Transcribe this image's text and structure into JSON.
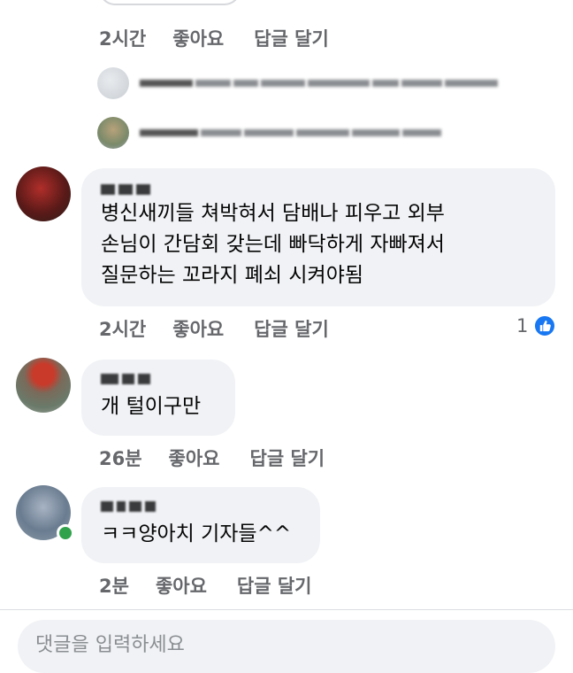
{
  "top_comment": {
    "time": "2시간",
    "like_label": "좋아요",
    "reply_label": "답글 달기"
  },
  "comments": [
    {
      "text_lines": [
        "병신새끼들 쳐박혀서 담배나 피우고 외부",
        "손님이 간담회 갖는데 빠닥하게 자빠져서",
        "질문하는 꼬라지 폐쇠 시켜야됨"
      ],
      "time": "2시간",
      "like_label": "좋아요",
      "reply_label": "답글 달기",
      "like_count": "1"
    },
    {
      "text": "개 털이구만",
      "time": "26분",
      "like_label": "좋아요",
      "reply_label": "답글 달기"
    },
    {
      "text": "ㅋㅋ양아치 기자들^^",
      "time": "2분",
      "like_label": "좋아요",
      "reply_label": "답글 달기"
    }
  ],
  "comment_input": {
    "placeholder": "댓글을 입력하세요"
  },
  "colors": {
    "bubble": "#f0f2f5",
    "secondary_text": "#65676b",
    "like_blue": "#1877f2",
    "online_green": "#31a24c"
  }
}
